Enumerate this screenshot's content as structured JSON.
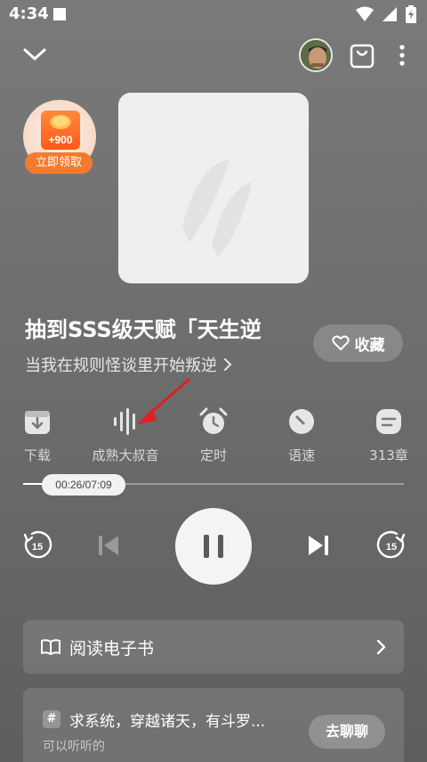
{
  "status_bar": {
    "time": "4:34"
  },
  "reward": {
    "amount": "+900",
    "label": "立即领取"
  },
  "book": {
    "title": "抽到SSS级天赋「天生逆",
    "subtitle": "当我在规则怪谈里开始叛逆",
    "collect_label": "收藏"
  },
  "functions": [
    {
      "icon": "download-icon",
      "label": "下载"
    },
    {
      "icon": "voice-wave-icon",
      "label": "成熟大叔音"
    },
    {
      "icon": "alarm-clock-icon",
      "label": "定时"
    },
    {
      "icon": "speed-gauge-icon",
      "label": "语速"
    },
    {
      "icon": "chapter-list-icon",
      "label": "313章"
    }
  ],
  "player": {
    "time_display": "00:26/07:09",
    "progress": 0.06,
    "rewind_seconds": "15",
    "forward_seconds": "15",
    "state": "playing"
  },
  "ebook": {
    "label": "阅读电子书"
  },
  "chat": {
    "hash": "#",
    "title": "求系统，穿越诸天，有斗罗...",
    "subtitle": "可以听听的",
    "button": "去聊聊"
  }
}
